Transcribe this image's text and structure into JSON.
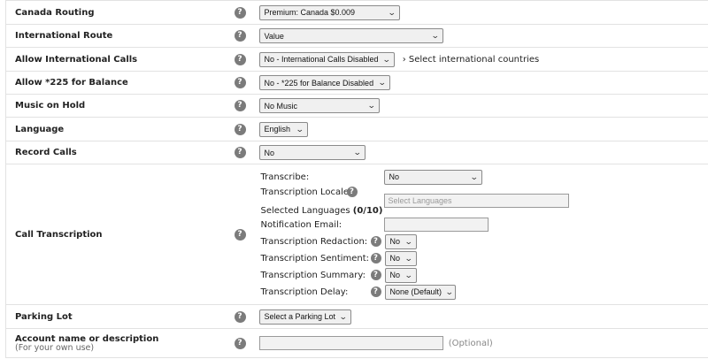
{
  "rows": {
    "canada_routing": {
      "label": "Canada Routing",
      "value": "Premium: Canada $0.009"
    },
    "international_route": {
      "label": "International Route",
      "value": "Value"
    },
    "allow_international": {
      "label": "Allow International Calls",
      "value": "No - International Calls Disabled",
      "link": "› Select international countries"
    },
    "allow_225": {
      "label": "Allow *225 for Balance",
      "value": "No - *225 for Balance Disabled"
    },
    "music_on_hold": {
      "label": "Music on Hold",
      "value": "No Music"
    },
    "language": {
      "label": "Language",
      "value": "English"
    },
    "record_calls": {
      "label": "Record Calls",
      "value": "No"
    },
    "call_transcription": {
      "label": "Call Transcription",
      "transcribe_label": "Transcribe:",
      "transcribe_value": "No",
      "locale_label": "Transcription Locale:",
      "locale_placeholder": "Select Languages",
      "selected_languages_label": "Selected Languages",
      "selected_languages_count": "(0/10)",
      "notification_email_label": "Notification Email:",
      "notification_email_value": "",
      "redaction_label": "Transcription Redaction:",
      "redaction_value": "No",
      "sentiment_label": "Transcription Sentiment:",
      "sentiment_value": "No",
      "summary_label": "Transcription Summary:",
      "summary_value": "No",
      "delay_label": "Transcription Delay:",
      "delay_value": "None (Default)"
    },
    "parking_lot": {
      "label": "Parking Lot",
      "value": "Select a Parking Lot"
    },
    "account_name": {
      "label": "Account name or description",
      "sublabel": "(For your own use)",
      "value": "",
      "optional": "(Optional)"
    }
  },
  "help_glyph": "?",
  "chevron_glyph": "⌄",
  "icons": {
    "help": "question-circle-icon",
    "dropdown": "chevron-down-icon"
  }
}
